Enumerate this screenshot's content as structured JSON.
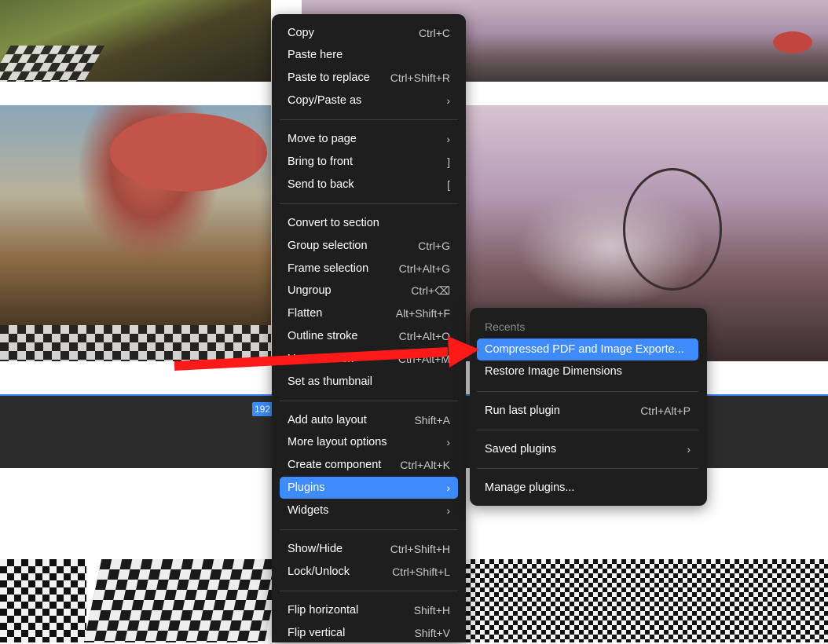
{
  "context_menu": {
    "sections": [
      [
        {
          "label": "Copy",
          "shortcut": "Ctrl+C"
        },
        {
          "label": "Paste here",
          "shortcut": ""
        },
        {
          "label": "Paste to replace",
          "shortcut": "Ctrl+Shift+R"
        },
        {
          "label": "Copy/Paste as",
          "shortcut": "›"
        }
      ],
      [
        {
          "label": "Move to page",
          "shortcut": "›"
        },
        {
          "label": "Bring to front",
          "shortcut": "]"
        },
        {
          "label": "Send to back",
          "shortcut": "["
        }
      ],
      [
        {
          "label": "Convert to section",
          "shortcut": ""
        },
        {
          "label": "Group selection",
          "shortcut": "Ctrl+G"
        },
        {
          "label": "Frame selection",
          "shortcut": "Ctrl+Alt+G"
        },
        {
          "label": "Ungroup",
          "shortcut": "Ctrl+⌫"
        },
        {
          "label": "Flatten",
          "shortcut": "Alt+Shift+F"
        },
        {
          "label": "Outline stroke",
          "shortcut": "Ctrl+Alt+O"
        },
        {
          "label": "Use as mask",
          "shortcut": "Ctrl+Alt+M"
        },
        {
          "label": "Set as thumbnail",
          "shortcut": ""
        }
      ],
      [
        {
          "label": "Add auto layout",
          "shortcut": "Shift+A"
        },
        {
          "label": "More layout options",
          "shortcut": "›"
        },
        {
          "label": "Create component",
          "shortcut": "Ctrl+Alt+K"
        },
        {
          "label": "Plugins",
          "shortcut": "›"
        },
        {
          "label": "Widgets",
          "shortcut": "›"
        }
      ],
      [
        {
          "label": "Show/Hide",
          "shortcut": "Ctrl+Shift+H"
        },
        {
          "label": "Lock/Unlock",
          "shortcut": "Ctrl+Shift+L"
        }
      ],
      [
        {
          "label": "Flip horizontal",
          "shortcut": "Shift+H"
        },
        {
          "label": "Flip vertical",
          "shortcut": "Shift+V"
        }
      ]
    ]
  },
  "plugins_submenu": {
    "header": "Recents",
    "items": [
      {
        "label": "Compressed PDF and Image Exporte...",
        "shortcut": ""
      },
      {
        "label": "Restore Image Dimensions",
        "shortcut": ""
      },
      {
        "label": "Run last plugin",
        "shortcut": "Ctrl+Alt+P"
      },
      {
        "label": "Saved plugins",
        "shortcut": "›"
      },
      {
        "label": "Manage plugins...",
        "shortcut": ""
      }
    ]
  },
  "canvas": {
    "dimension_badge": "192"
  },
  "colors": {
    "menu_bg": "#1e1e1e",
    "highlight": "#3d8bfd",
    "annotation_arrow": "#ff1a1a"
  }
}
